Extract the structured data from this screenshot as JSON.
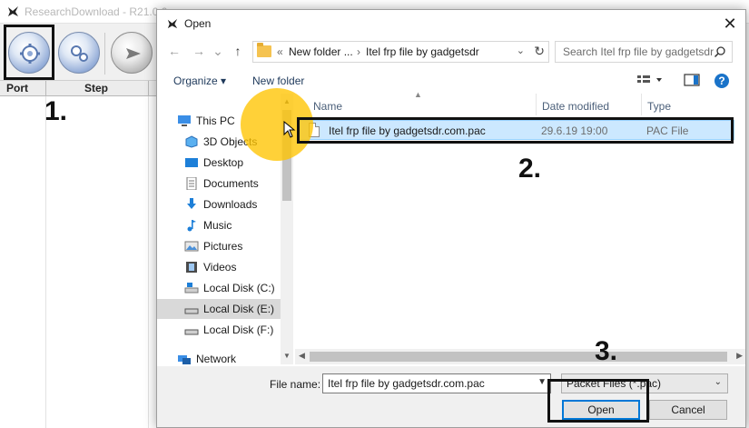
{
  "app": {
    "title": "ResearchDownload - R21.0.0",
    "grid_columns": [
      "Port",
      "Step"
    ]
  },
  "annotations": {
    "step1": "1.",
    "step2": "2.",
    "step3": "3."
  },
  "dialog": {
    "title": "Open",
    "close_glyph": "✕",
    "nav": {
      "back": "←",
      "forward": "→",
      "recent": "⌄",
      "up": "↑"
    },
    "breadcrumb": {
      "overflow": "«",
      "items": [
        "New folder ...",
        "Itel frp file by gadgetsdr"
      ],
      "separator": "›"
    },
    "search_placeholder": "Search Itel frp file by gadgetsdr",
    "toolbar": {
      "organize": "Organize ▾",
      "new_folder": "New folder",
      "help": "?"
    },
    "nav_pane": [
      {
        "label": "This PC",
        "icon": "computer-icon"
      },
      {
        "label": "3D Objects",
        "icon": "cube-icon"
      },
      {
        "label": "Desktop",
        "icon": "desktop-icon"
      },
      {
        "label": "Documents",
        "icon": "documents-icon"
      },
      {
        "label": "Downloads",
        "icon": "download-icon"
      },
      {
        "label": "Music",
        "icon": "music-icon"
      },
      {
        "label": "Pictures",
        "icon": "pictures-icon"
      },
      {
        "label": "Videos",
        "icon": "videos-icon"
      },
      {
        "label": "Local Disk (C:)",
        "icon": "drive-c-icon"
      },
      {
        "label": "Local Disk (E:)",
        "icon": "drive-icon",
        "selected": true
      },
      {
        "label": "Local Disk (F:)",
        "icon": "drive-icon"
      },
      {
        "label": "Network",
        "icon": "network-icon"
      }
    ],
    "columns": [
      "Name",
      "Date modified",
      "Type"
    ],
    "files": [
      {
        "name": "Itel frp file by gadgetsdr.com.pac",
        "date": "29.6.19 19:00",
        "type": "PAC File"
      }
    ],
    "file_name_label": "File name:",
    "file_name_value": "Itel frp file by gadgetsdr.com.pac",
    "file_type": "Packet Files (*.pac)",
    "open_button": "Open",
    "cancel_button": "Cancel"
  },
  "colors": {
    "selection": "#cce8ff",
    "accent": "#0078d7",
    "highlight": "#ffc400"
  }
}
